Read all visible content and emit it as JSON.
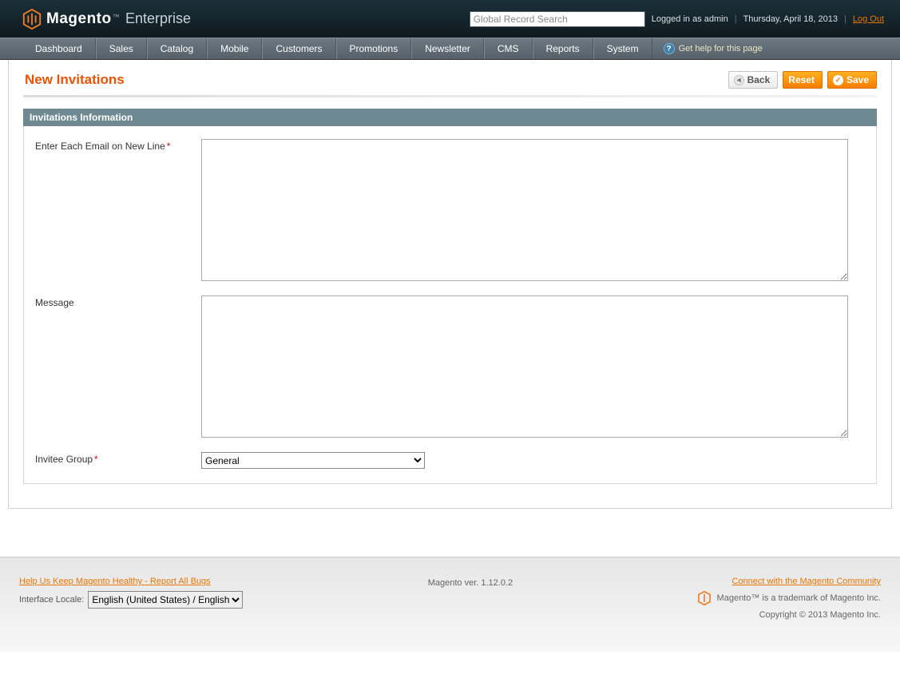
{
  "header": {
    "brand_main": "Magento",
    "brand_tm": "™",
    "brand_sub": "Enterprise",
    "search_placeholder": "Global Record Search",
    "login_text": "Logged in as admin",
    "date_text": "Thursday, April 18, 2013",
    "logout_text": "Log Out"
  },
  "nav": {
    "items": [
      "Dashboard",
      "Sales",
      "Catalog",
      "Mobile",
      "Customers",
      "Promotions",
      "Newsletter",
      "CMS",
      "Reports",
      "System"
    ],
    "help_text": "Get help for this page"
  },
  "page": {
    "title": "New Invitations",
    "back_label": "Back",
    "reset_label": "Reset",
    "save_label": "Save"
  },
  "section": {
    "heading": "Invitations Information",
    "email_label": "Enter Each Email on New Line",
    "email_required": true,
    "email_value": "",
    "message_label": "Message",
    "message_value": "",
    "group_label": "Invitee Group",
    "group_required": true,
    "group_selected": "General"
  },
  "footer": {
    "bugs_link": "Help Us Keep Magento Healthy - Report All Bugs",
    "locale_label": "Interface Locale:",
    "locale_selected": "English (United States) / English",
    "version_text": "Magento ver. 1.12.0.2",
    "community_link": "Connect with the Magento Community",
    "trademark_text": "Magento™ is a trademark of Magento Inc.",
    "copyright_text": "Copyright © 2013 Magento Inc."
  }
}
